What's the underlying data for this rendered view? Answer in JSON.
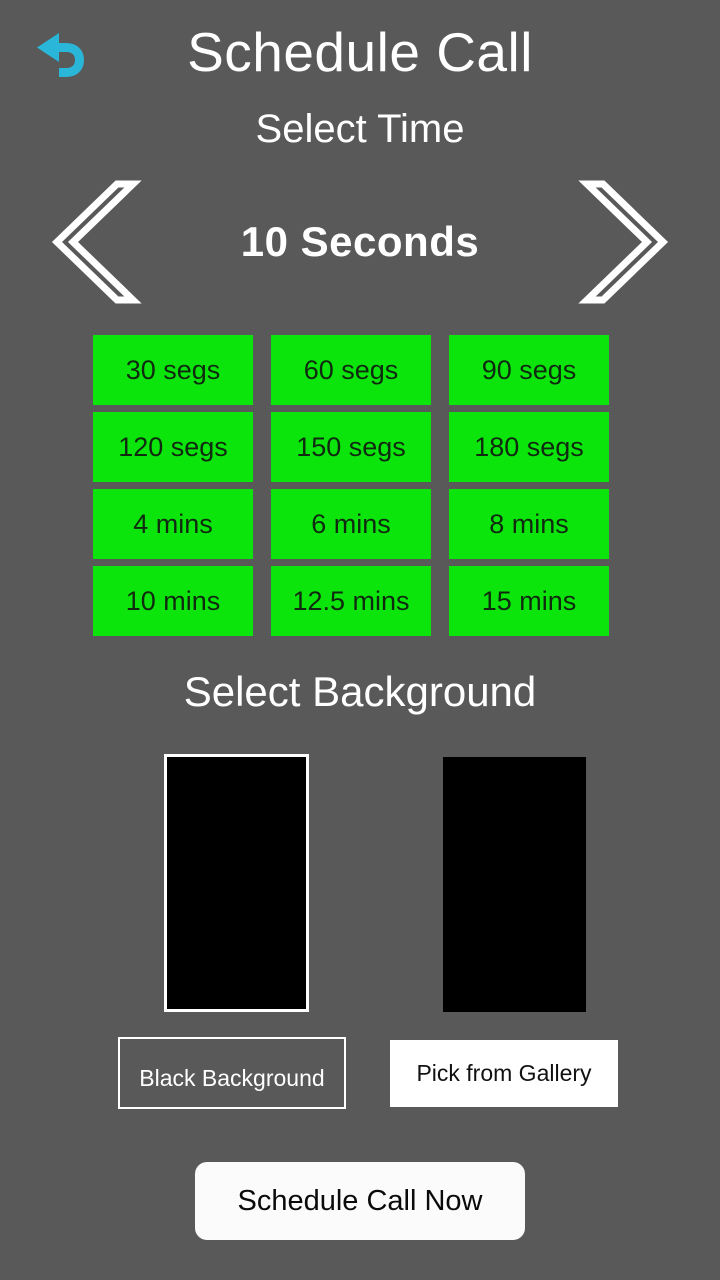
{
  "header": {
    "title": "Schedule Call",
    "back_icon": "back-arrow-icon"
  },
  "time_section": {
    "label": "Select Time",
    "prev_icon": "chevron-left-icon",
    "next_icon": "chevron-right-icon",
    "current_value": "10 Seconds",
    "presets": [
      {
        "label": "30 segs"
      },
      {
        "label": "60 segs"
      },
      {
        "label": "90 segs"
      },
      {
        "label": "120 segs"
      },
      {
        "label": "150 segs"
      },
      {
        "label": "180 segs"
      },
      {
        "label": "4 mins"
      },
      {
        "label": "6 mins"
      },
      {
        "label": "8 mins"
      },
      {
        "label": "10 mins"
      },
      {
        "label": "12.5 mins"
      },
      {
        "label": "15 mins"
      }
    ]
  },
  "background_section": {
    "label": "Select Background",
    "black_button_label": "Black Background",
    "gallery_button_label": "Pick from Gallery"
  },
  "cta": {
    "label": "Schedule Call Now"
  },
  "colors": {
    "page_background": "#595959",
    "preset_green": "#0be50b",
    "preset_text": "#102a10",
    "text_white": "#ffffff",
    "back_arrow": "#29b6d8",
    "preview_black": "#000000",
    "cta_background": "#fbfbfb"
  }
}
